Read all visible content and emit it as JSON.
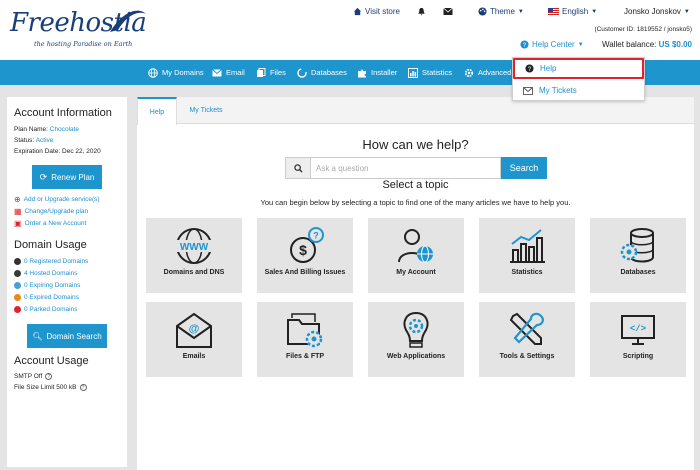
{
  "brand": {
    "name": "Freehostia",
    "tagline": "the hosting Paradise on Earth"
  },
  "topnav": {
    "visit_store": "Visit store",
    "theme": "Theme",
    "language": "English",
    "user": "Jonsko Jonskov",
    "customer_id": "(Customer ID: 1819552 / jonsko5)",
    "help_center": "Help Center",
    "wallet_label": "Wallet balance:",
    "wallet_value": "US $0.00"
  },
  "mainnav": {
    "items": [
      {
        "label": "My Domains",
        "icon": "globe-icon"
      },
      {
        "label": "Email",
        "icon": "envelope-icon"
      },
      {
        "label": "Files",
        "icon": "files-icon"
      },
      {
        "label": "Databases",
        "icon": "database-icon"
      },
      {
        "label": "Installer",
        "icon": "puzzle-icon"
      },
      {
        "label": "Statistics",
        "icon": "chart-icon"
      },
      {
        "label": "Advanced",
        "icon": "gear-icon"
      }
    ]
  },
  "dropdown": {
    "help": "Help",
    "tickets": "My Tickets"
  },
  "sidebar": {
    "account_title": "Account Information",
    "plan_label": "Plan Name:",
    "plan_value": "Chocolate",
    "status_label": "Status:",
    "status_value": "Active",
    "expiration": "Expiration Date: Dec 22, 2020",
    "renew_button": "Renew Plan",
    "links": [
      "Add or Upgrade service(s)",
      "Change/Upgrade plan",
      "Order a New Account"
    ],
    "domain_title": "Domain Usage",
    "domain_stats": [
      {
        "text": "0 Registered Domains",
        "color": "#333333"
      },
      {
        "text": "4 Hosted Domains",
        "color": "#3a3a3a"
      },
      {
        "text": "0 Expiring Domains",
        "color": "#4a9fd6"
      },
      {
        "text": "0 Expired Domains",
        "color": "#e88a1a"
      },
      {
        "text": "0 Parked Domains",
        "color": "#d9262c"
      }
    ],
    "domain_search_button": "Domain Search",
    "usage_title": "Account Usage",
    "smtp": "SMTP Off",
    "file_size": "File Size Limit 500 kB"
  },
  "tabs": {
    "help": "Help",
    "tickets": "My Tickets"
  },
  "help": {
    "heading": "How can we help?",
    "search_placeholder": "Ask a question",
    "search_button": "Search",
    "topic_heading": "Select a topic",
    "topic_sub": "You can begin below by selecting a topic to find one of the many articles we have to help you."
  },
  "topics": [
    "Domains and DNS",
    "Sales And Billing Issues",
    "My Account",
    "Statistics",
    "Databases",
    "Emails",
    "Files & FTP",
    "Web Applications",
    "Tools & Settings",
    "Scripting"
  ],
  "colors": {
    "accent": "#1f95cd",
    "brand": "#1a3e78",
    "highlight": "#d9262c"
  }
}
